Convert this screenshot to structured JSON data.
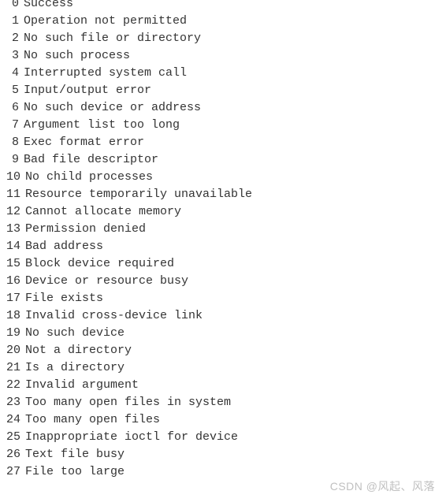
{
  "lines": [
    {
      "num": "0",
      "text": "Success"
    },
    {
      "num": "1",
      "text": "Operation not permitted"
    },
    {
      "num": "2",
      "text": "No such file or directory"
    },
    {
      "num": "3",
      "text": "No such process"
    },
    {
      "num": "4",
      "text": "Interrupted system call"
    },
    {
      "num": "5",
      "text": "Input/output error"
    },
    {
      "num": "6",
      "text": "No such device or address"
    },
    {
      "num": "7",
      "text": "Argument list too long"
    },
    {
      "num": "8",
      "text": "Exec format error"
    },
    {
      "num": "9",
      "text": "Bad file descriptor"
    },
    {
      "num": "10",
      "text": "No child processes"
    },
    {
      "num": "11",
      "text": "Resource temporarily unavailable"
    },
    {
      "num": "12",
      "text": "Cannot allocate memory"
    },
    {
      "num": "13",
      "text": "Permission denied"
    },
    {
      "num": "14",
      "text": "Bad address"
    },
    {
      "num": "15",
      "text": "Block device required"
    },
    {
      "num": "16",
      "text": "Device or resource busy"
    },
    {
      "num": "17",
      "text": "File exists"
    },
    {
      "num": "18",
      "text": "Invalid cross-device link"
    },
    {
      "num": "19",
      "text": "No such device"
    },
    {
      "num": "20",
      "text": "Not a directory"
    },
    {
      "num": "21",
      "text": "Is a directory"
    },
    {
      "num": "22",
      "text": "Invalid argument"
    },
    {
      "num": "23",
      "text": "Too many open files in system"
    },
    {
      "num": "24",
      "text": "Too many open files"
    },
    {
      "num": "25",
      "text": "Inappropriate ioctl for device"
    },
    {
      "num": "26",
      "text": "Text file busy"
    },
    {
      "num": "27",
      "text": "File too large"
    }
  ],
  "watermark": "CSDN @风起、风落"
}
